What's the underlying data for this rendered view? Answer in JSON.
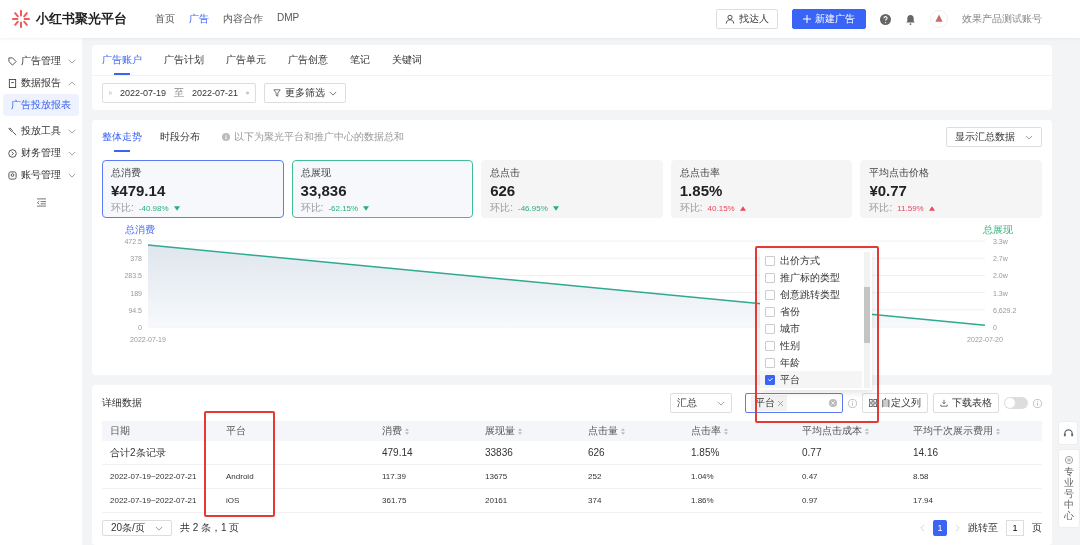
{
  "header": {
    "brand": "小红书聚光平台",
    "nav": [
      {
        "label": "首页",
        "selected": false
      },
      {
        "label": "广告",
        "selected": true
      },
      {
        "label": "内容合作",
        "selected": false
      },
      {
        "label": "DMP",
        "selected": false
      }
    ],
    "find_button": "找达人",
    "new_button": "新建广告",
    "account": "效果产品测试账号"
  },
  "sidebar": {
    "items": [
      {
        "label": "广告管理",
        "expanded": false
      },
      {
        "label": "数据报告",
        "expanded": true,
        "children": [
          {
            "label": "广告投放报表",
            "selected": true
          }
        ]
      },
      {
        "label": "投放工具",
        "expanded": false
      },
      {
        "label": "财务管理",
        "expanded": false
      },
      {
        "label": "账号管理",
        "expanded": false
      }
    ]
  },
  "report_tabs": [
    {
      "label": "广告账户",
      "selected": true
    },
    {
      "label": "广告计划",
      "selected": false
    },
    {
      "label": "广告单元",
      "selected": false
    },
    {
      "label": "广告创意",
      "selected": false
    },
    {
      "label": "笔记",
      "selected": false
    },
    {
      "label": "关键词",
      "selected": false
    }
  ],
  "date_range": {
    "start": "2022-07-19",
    "separator": "至",
    "end": "2022-07-21"
  },
  "more_filter": "更多筛选",
  "trend": {
    "tabs": [
      {
        "label": "整体走势",
        "selected": true
      },
      {
        "label": "时段分布",
        "selected": false
      }
    ],
    "note": "以下为聚光平台和推广中心的数据总和",
    "summary_select": "显示汇总数据",
    "metrics": [
      {
        "label": "总消费",
        "value": "¥479.14",
        "change_label": "环比:",
        "change": "-40.98%",
        "rising": false,
        "selected": true,
        "color": "#5b7cf5"
      },
      {
        "label": "总展现",
        "value": "33,836",
        "change_label": "环比:",
        "change": "-62.15%",
        "rising": false,
        "selected": true,
        "color": "#3fbf94"
      },
      {
        "label": "总点击",
        "value": "626",
        "change_label": "环比:",
        "change": "-46.95%",
        "rising": false,
        "selected": false
      },
      {
        "label": "总点击率",
        "value": "1.85%",
        "change_label": "环比:",
        "change": "40.15%",
        "rising": true,
        "selected": false
      },
      {
        "label": "平均点击价格",
        "value": "¥0.77",
        "change_label": "环比:",
        "change": "11.59%",
        "rising": true,
        "selected": false
      }
    ],
    "chart_data": {
      "type": "area",
      "ylabel": "总消费",
      "categories": [
        "2022-07-19",
        "2022-07-20"
      ],
      "series": [
        {
          "color": "#2fa98f",
          "values": [
            450,
            10
          ]
        }
      ],
      "ylim": [
        0,
        472.5
      ],
      "yticks": [
        0,
        94.5,
        189,
        283.5,
        378,
        472.5
      ]
    },
    "right_axis": {
      "label": "总展现",
      "ticks": [
        "3.3w",
        "2.7w",
        "2.0w",
        "1.3w",
        "6,629.2",
        "0"
      ]
    }
  },
  "detail": {
    "title": "详细数据",
    "group_select": "汇总",
    "dimension_tags": [
      "平台"
    ],
    "custom_columns": "自定义列",
    "download": "下载表格",
    "toggle_on": false,
    "dimension_options": [
      {
        "label": "出价方式",
        "checked": false
      },
      {
        "label": "推广标的类型",
        "checked": false
      },
      {
        "label": "创意跳转类型",
        "checked": false
      },
      {
        "label": "省份",
        "checked": false
      },
      {
        "label": "城市",
        "checked": false
      },
      {
        "label": "性别",
        "checked": false
      },
      {
        "label": "年龄",
        "checked": false
      },
      {
        "label": "平台",
        "checked": true
      }
    ],
    "columns": [
      {
        "label": "日期",
        "sortable": false
      },
      {
        "label": "平台",
        "sortable": false
      },
      {
        "label": "消费",
        "sortable": true
      },
      {
        "label": "展现量",
        "sortable": true
      },
      {
        "label": "点击量",
        "sortable": true
      },
      {
        "label": "点击率",
        "sortable": true
      },
      {
        "label": "平均点击成本",
        "sortable": true
      },
      {
        "label": "平均千次展示费用",
        "sortable": true
      }
    ],
    "rows": [
      [
        "合计2条记录",
        "",
        "479.14",
        "33836",
        "626",
        "1.85%",
        "0.77",
        "14.16"
      ],
      [
        "2022-07-19~2022-07-21",
        "Android",
        "117.39",
        "13675",
        "252",
        "1.04%",
        "0.47",
        "8.58"
      ],
      [
        "2022-07-19~2022-07-21",
        "iOS",
        "361.75",
        "20161",
        "374",
        "1.86%",
        "0.97",
        "17.94"
      ]
    ],
    "page_size": "20条/页",
    "total": "共 2 条，1 页",
    "pages": [
      {
        "label": "1",
        "selected": true
      }
    ],
    "jump_label": "跳转至",
    "jump_value": "1",
    "page_unit": "页"
  },
  "float_panel": {
    "label": "专业号中心"
  }
}
